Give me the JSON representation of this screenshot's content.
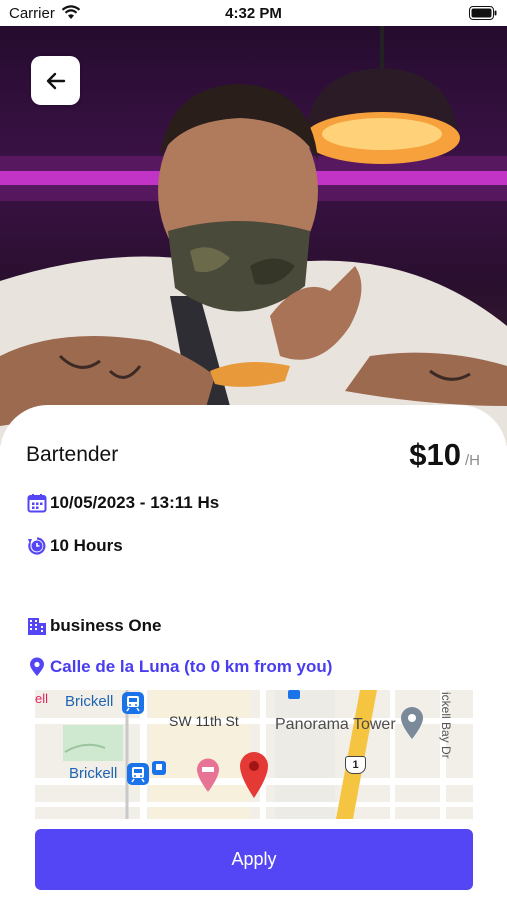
{
  "status_bar": {
    "carrier": "Carrier",
    "time": "4:32 PM"
  },
  "job": {
    "title": "Bartender",
    "price": "$10",
    "price_unit": "/H",
    "date": "10/05/2023 - 13:11 Hs",
    "duration": "10 Hours",
    "business": "business One",
    "location": "Calle de la Luna (to 0 km from you)"
  },
  "map": {
    "labels": {
      "brickell_top": "Brickell",
      "brickell_bottom": "Brickell",
      "street": "SW 11th St",
      "poi": "Panorama Tower",
      "bay": "ickell Bay Dr",
      "edge": "ell",
      "route": "1"
    }
  },
  "actions": {
    "apply_label": "Apply"
  },
  "colors": {
    "accent": "#5546f5",
    "location_text": "#4a3df0",
    "map_pin": "#e53935",
    "hotel_pin": "#e87495"
  },
  "icons": [
    "back-arrow-icon",
    "calendar-icon",
    "clock-icon",
    "building-icon",
    "location-pin-icon",
    "wifi-icon",
    "battery-icon",
    "transit-icon",
    "map-pin-icon",
    "hotel-pin-icon"
  ]
}
